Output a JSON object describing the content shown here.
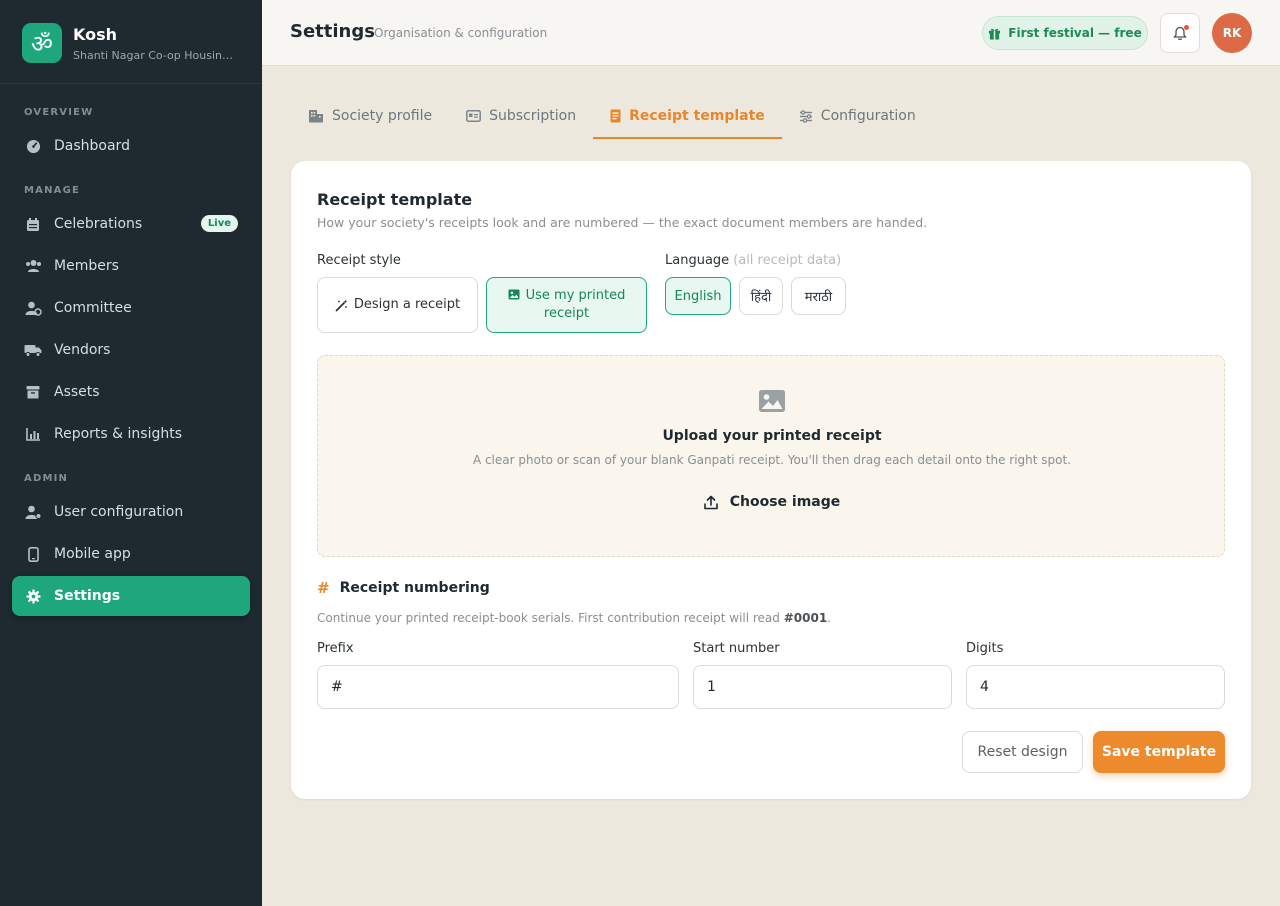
{
  "brand": {
    "name": "Kosh",
    "subtitle": "Shanti Nagar Co-op Housin…",
    "logo_glyph": "ॐ"
  },
  "sidebar": {
    "sections": [
      {
        "label": "OVERVIEW",
        "items": [
          {
            "label": "Dashboard",
            "icon": "gauge-icon"
          }
        ]
      },
      {
        "label": "MANAGE",
        "items": [
          {
            "label": "Celebrations",
            "icon": "calendar-icon",
            "badge": "Live"
          },
          {
            "label": "Members",
            "icon": "users-icon"
          },
          {
            "label": "Committee",
            "icon": "user-tie-icon"
          },
          {
            "label": "Vendors",
            "icon": "truck-icon"
          },
          {
            "label": "Assets",
            "icon": "archive-icon"
          },
          {
            "label": "Reports & insights",
            "icon": "chart-icon"
          }
        ]
      },
      {
        "label": "ADMIN",
        "items": [
          {
            "label": "User configuration",
            "icon": "user-gear-icon"
          },
          {
            "label": "Mobile app",
            "icon": "mobile-icon"
          },
          {
            "label": "Settings",
            "icon": "gear-icon",
            "active": true
          }
        ]
      }
    ]
  },
  "header": {
    "title": "Settings",
    "subtitle": "Organisation & configuration",
    "promo": "First festival — free",
    "avatar_initials": "RK"
  },
  "tabs": [
    {
      "label": "Society profile",
      "icon": "building-icon"
    },
    {
      "label": "Subscription",
      "icon": "id-card-icon"
    },
    {
      "label": "Receipt template",
      "icon": "receipt-icon",
      "active": true
    },
    {
      "label": "Configuration",
      "icon": "sliders-icon"
    }
  ],
  "card": {
    "title": "Receipt template",
    "description": "How your society's receipts look and are numbered — the exact document members are handed.",
    "receipt_style": {
      "label": "Receipt style",
      "options": [
        {
          "label": "Design a receipt",
          "icon": "magic-wand-icon"
        },
        {
          "label": "Use my printed receipt",
          "icon": "image-icon",
          "selected": true
        }
      ]
    },
    "language": {
      "label": "Language",
      "hint": "(all receipt data)",
      "options": [
        {
          "label": "English",
          "selected": true
        },
        {
          "label": "हिंदी"
        },
        {
          "label": "मराठी"
        }
      ]
    },
    "upload": {
      "title": "Upload your printed receipt",
      "description": "A clear photo or scan of your blank Ganpati receipt. You'll then drag each detail onto the right spot.",
      "button": "Choose image"
    },
    "numbering": {
      "title": "Receipt numbering",
      "description_prefix": "Continue your printed receipt-book serials. First contribution receipt will read ",
      "example": "#0001",
      "description_suffix": ".",
      "fields": {
        "prefix": {
          "label": "Prefix",
          "value": "#"
        },
        "start": {
          "label": "Start number",
          "value": "1"
        },
        "digits": {
          "label": "Digits",
          "value": "4"
        }
      }
    },
    "actions": {
      "reset": "Reset design",
      "save": "Save template"
    }
  },
  "colors": {
    "accent_green": "#1ea77d",
    "accent_orange": "#e8862b",
    "sidebar_bg": "#1e2a30"
  }
}
